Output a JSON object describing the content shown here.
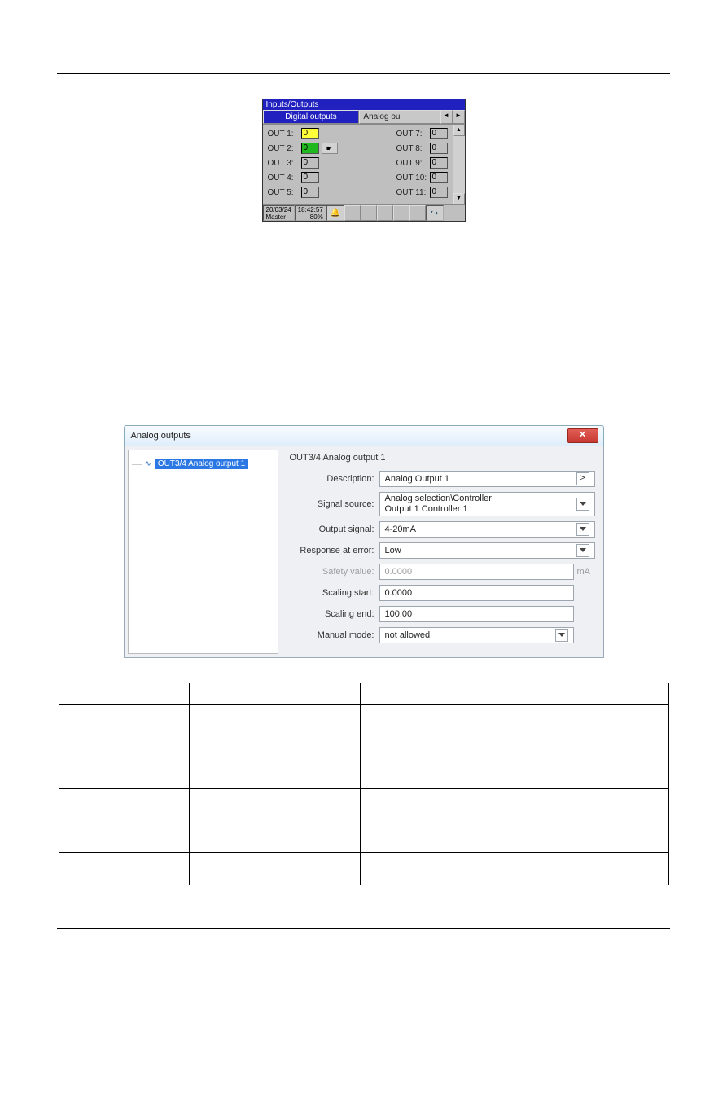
{
  "panel1": {
    "title": "Inputs/Outputs",
    "tab_active": "Digital outputs",
    "tab_inactive": "Analog ou",
    "left_rows": [
      {
        "label": "OUT 1:",
        "value": "0",
        "color": "yellow",
        "hand": false
      },
      {
        "label": "OUT 2:",
        "value": "0",
        "color": "green",
        "hand": true
      },
      {
        "label": "OUT 3:",
        "value": "0",
        "color": "",
        "hand": false
      },
      {
        "label": "OUT 4:",
        "value": "0",
        "color": "",
        "hand": false
      },
      {
        "label": "OUT 5:",
        "value": "0",
        "color": "",
        "hand": false
      }
    ],
    "right_rows": [
      {
        "label": "OUT 7:",
        "value": "0"
      },
      {
        "label": "OUT 8:",
        "value": "0"
      },
      {
        "label": "OUT 9:",
        "value": "0"
      },
      {
        "label": "OUT 10:",
        "value": "0"
      },
      {
        "label": "OUT 11:",
        "value": "0"
      }
    ],
    "status": {
      "date": "20/03/24",
      "user": "Master",
      "time": "18:42:57",
      "pct": "80%"
    }
  },
  "dlg": {
    "title": "Analog outputs",
    "tree_item": "OUT3/4 Analog output 1",
    "form_title": "OUT3/4 Analog output 1",
    "description": {
      "label": "Description:",
      "value": "Analog Output 1"
    },
    "signal_source": {
      "label": "Signal source:",
      "value": "Analog selection\\Controller\nOutput 1 Controller 1"
    },
    "output_signal": {
      "label": "Output signal:",
      "value": "4-20mA"
    },
    "response_at_error": {
      "label": "Response at error:",
      "value": "Low"
    },
    "safety_value": {
      "label": "Safety value:",
      "value": "0.0000",
      "unit": "mA"
    },
    "scaling_start": {
      "label": "Scaling start:",
      "value": "0.0000"
    },
    "scaling_end": {
      "label": "Scaling end:",
      "value": "100.00"
    },
    "manual_mode": {
      "label": "Manual mode:",
      "value": "not allowed"
    }
  },
  "icons": {
    "arrow_left": "◄",
    "arrow_right": "►",
    "scroll_up": "▲",
    "scroll_down": "▼",
    "hand": "☛",
    "bell": "🔔",
    "exit": "↪",
    "close_x": "✕",
    "gt": ">"
  }
}
